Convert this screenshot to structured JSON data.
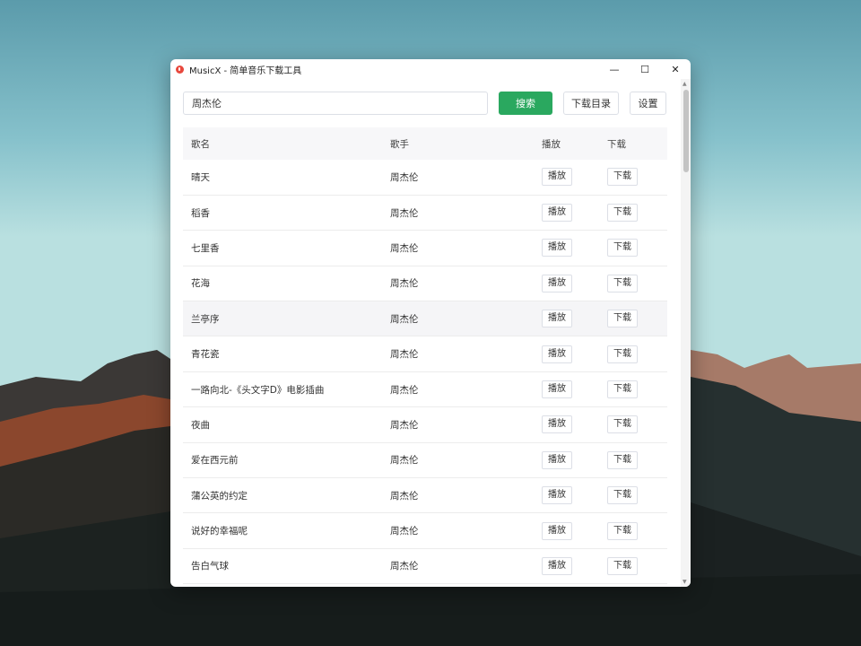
{
  "window": {
    "title": "MusicX - 简单音乐下载工具",
    "controls": {
      "minimize": "—",
      "maximize": "☐",
      "close": "✕"
    }
  },
  "toolbar": {
    "search_value": "周杰伦",
    "search_label": "搜索",
    "dir_label": "下载目录",
    "settings_label": "设置"
  },
  "table": {
    "headers": {
      "name": "歌名",
      "artist": "歌手",
      "play": "播放",
      "download": "下载"
    },
    "play_label": "播放",
    "download_label": "下载",
    "rows": [
      {
        "name": "晴天",
        "artist": "周杰伦"
      },
      {
        "name": "稻香",
        "artist": "周杰伦"
      },
      {
        "name": "七里香",
        "artist": "周杰伦"
      },
      {
        "name": "花海",
        "artist": "周杰伦"
      },
      {
        "name": "兰亭序",
        "artist": "周杰伦"
      },
      {
        "name": "青花瓷",
        "artist": "周杰伦"
      },
      {
        "name": "一路向北-《头文字D》电影插曲",
        "artist": "周杰伦"
      },
      {
        "name": "夜曲",
        "artist": "周杰伦"
      },
      {
        "name": "爱在西元前",
        "artist": "周杰伦"
      },
      {
        "name": "蒲公英的约定",
        "artist": "周杰伦"
      },
      {
        "name": "说好的幸福呢",
        "artist": "周杰伦"
      },
      {
        "name": "告白气球",
        "artist": "周杰伦"
      }
    ],
    "hovered_row": 4
  },
  "colors": {
    "accent": "#2aa85f",
    "app_icon": "#e8483d"
  }
}
